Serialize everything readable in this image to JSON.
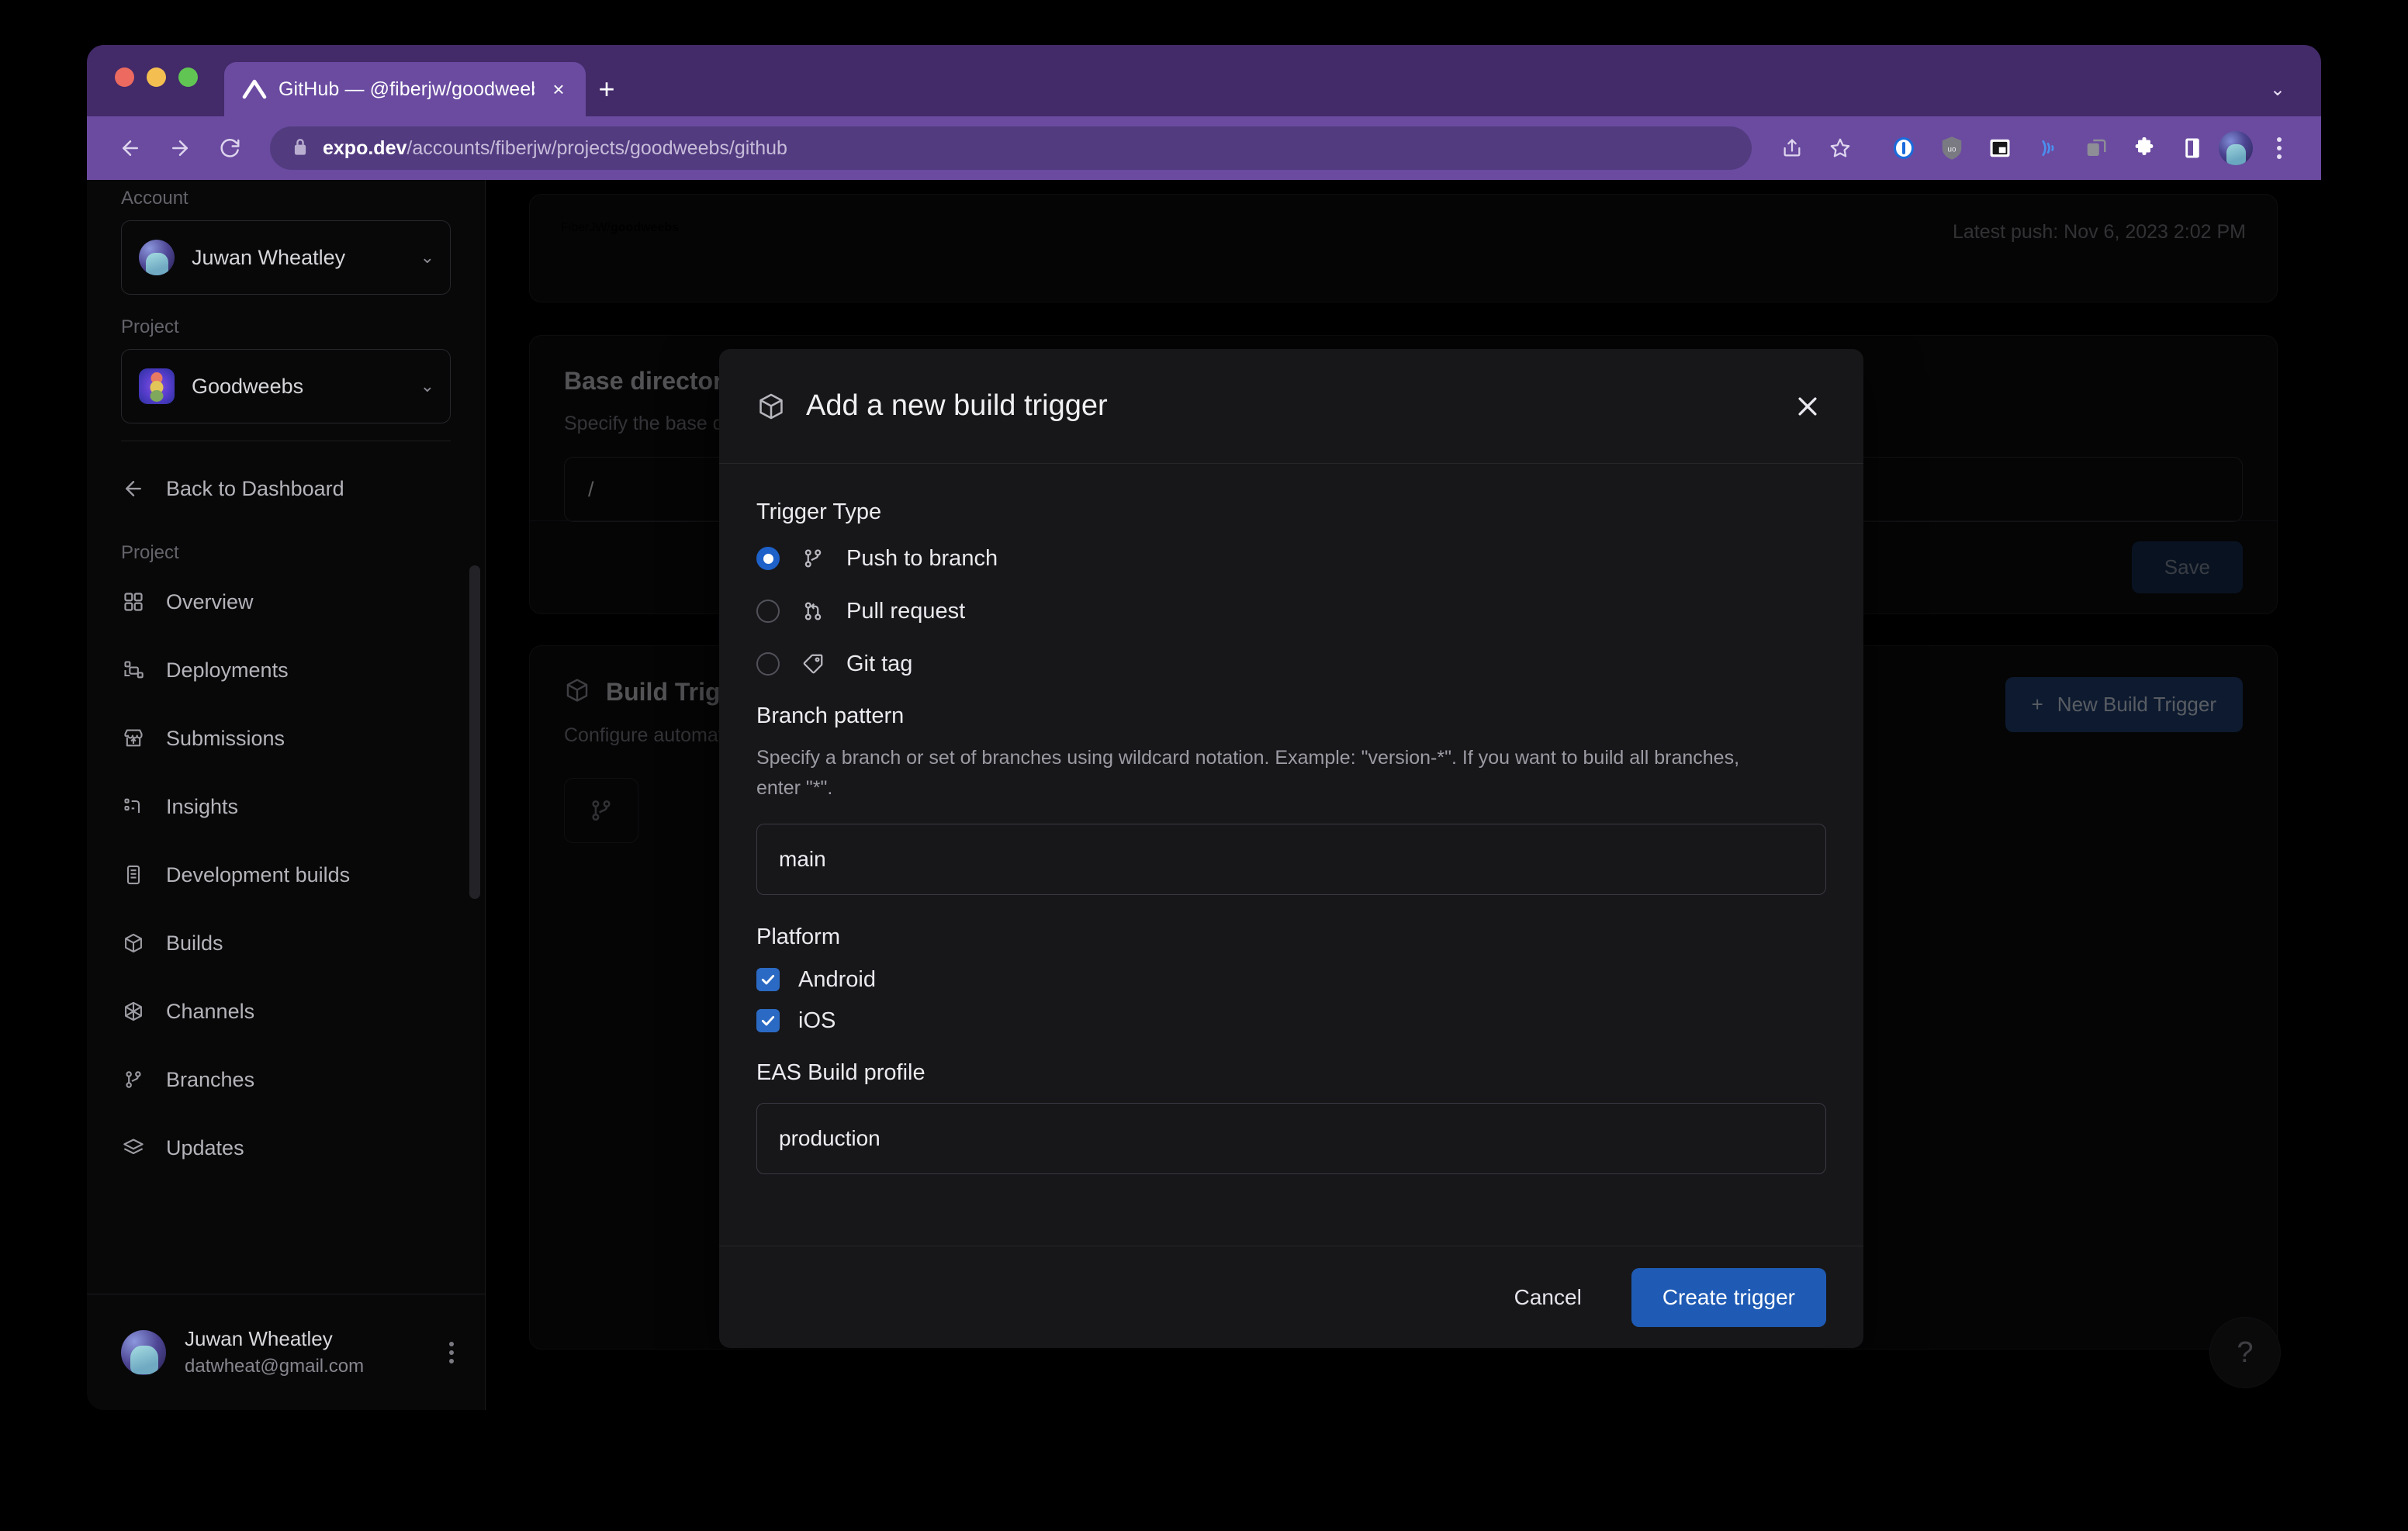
{
  "browser": {
    "tab": {
      "title": "GitHub — @fiberjw/goodweebs",
      "favicon": "expo-logo-icon",
      "close": "×"
    },
    "new_tab_label": "+",
    "tab_list_chevron": "⌄",
    "nav": {
      "back": "back-arrow-icon",
      "forward": "forward-arrow-icon",
      "reload": "reload-icon"
    },
    "url": {
      "lock": "lock-icon",
      "domain": "expo.dev",
      "path": "/accounts/fiberjw/projects/goodweebs/github"
    },
    "actions": [
      "share-icon",
      "bookmark-star-icon",
      "onepassword-icon",
      "ublock-origin-icon",
      "picture-in-picture-icon",
      "cast-icon",
      "tab-group-icon",
      "extensions-puzzle-icon",
      "side-panel-icon"
    ],
    "profile": "profile-avatar",
    "menu": "three-dot-menu-icon"
  },
  "sidebar": {
    "account_label": "Account",
    "account_name": "Juwan Wheatley",
    "project_label": "Project",
    "project_name": "Goodweebs",
    "back_label": "Back to Dashboard",
    "nav_group_label": "Project",
    "nav_items": [
      {
        "label": "Overview",
        "icon": "grid-icon"
      },
      {
        "label": "Deployments",
        "icon": "deployments-icon"
      },
      {
        "label": "Submissions",
        "icon": "store-upload-icon"
      },
      {
        "label": "Insights",
        "icon": "insights-icon"
      },
      {
        "label": "Development builds",
        "icon": "phone-icon"
      },
      {
        "label": "Builds",
        "icon": "cube-icon"
      },
      {
        "label": "Channels",
        "icon": "channels-icon"
      },
      {
        "label": "Branches",
        "icon": "branch-icon"
      },
      {
        "label": "Updates",
        "icon": "layers-icon"
      }
    ],
    "footer": {
      "name": "Juwan Wheatley",
      "email": "datwheat@gmail.com",
      "menu": "three-dot-menu-icon"
    }
  },
  "main": {
    "repo": {
      "owner": "FiberJW/",
      "name": "goodweebs",
      "latest_push": "Latest push: Nov 6, 2023 2:02 PM"
    },
    "base_directory": {
      "title": "Base directory",
      "description": "Specify the base directory of your project. If your project is in the root of the repository, you may leave this field blank.",
      "value": "/",
      "save_label": "Save"
    },
    "build_triggers": {
      "title": "Build Triggers",
      "description": "Configure automatic builds triggered by GitHub events.",
      "new_trigger_label": "New Build Trigger",
      "new_trigger_plus": "+"
    },
    "help_label": "?"
  },
  "modal": {
    "title": "Add a new build trigger",
    "header_icon": "cube-icon",
    "close_label": "×",
    "trigger_type": {
      "label": "Trigger Type",
      "options": [
        {
          "label": "Push to branch",
          "icon": "branch-icon",
          "selected": true
        },
        {
          "label": "Pull request",
          "icon": "pull-request-icon",
          "selected": false
        },
        {
          "label": "Git tag",
          "icon": "tag-icon",
          "selected": false
        }
      ]
    },
    "branch_pattern": {
      "label": "Branch pattern",
      "help": "Specify a branch or set of branches using wildcard notation. Example: \"version-*\". If you want to build all branches, enter \"*\".",
      "value": "main",
      "placeholder": "main"
    },
    "platform": {
      "label": "Platform",
      "options": [
        {
          "label": "Android",
          "checked": true
        },
        {
          "label": "iOS",
          "checked": true
        }
      ]
    },
    "build_profile": {
      "label": "EAS Build profile",
      "value": "production",
      "placeholder": "production"
    },
    "cancel_label": "Cancel",
    "create_label": "Create trigger"
  },
  "colors": {
    "browser_chrome": "#6a4ba0",
    "tab_strip": "#432a69",
    "accent_blue": "#1f5bb5",
    "checkbox_blue": "#2b6ac4",
    "radio_blue": "#1d61c9",
    "modal_bg": "#17171a",
    "page_bg": "#000000"
  }
}
